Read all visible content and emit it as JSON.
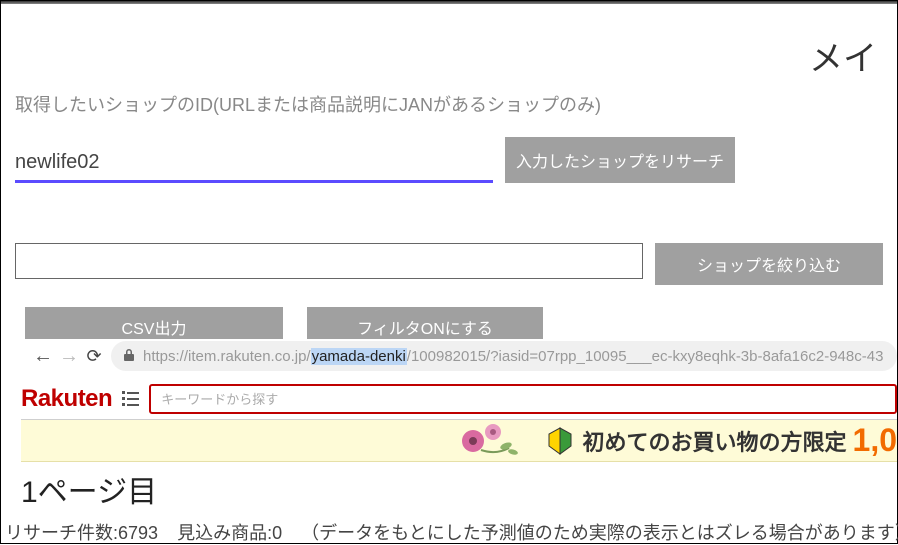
{
  "header": {
    "title_partial": "メイ"
  },
  "form": {
    "shop_id_label": "取得したいショップのID(URLまたは商品説明にJANがあるショップのみ)",
    "shop_id_value": "newlife02",
    "research_button": "入力したショップをリサーチ",
    "filter_value": "",
    "filter_button": "ショップを絞り込む",
    "csv_button": "CSV出力",
    "filter_toggle_button": "フィルタONにする"
  },
  "browser": {
    "url_prefix": "https://item.rakuten.co.jp/",
    "url_highlighted": "yamada-denki",
    "url_suffix": "/100982015/?iasid=07rpp_10095___ec-kxy8eqhk-3b-8afa16c2-948c-43"
  },
  "rakuten": {
    "logo": "Rakuten",
    "search_placeholder": "キーワードから探す"
  },
  "promo": {
    "text": "初めてのお買い物の方限定",
    "price_partial": "1,0"
  },
  "page": {
    "heading": "1ページ目",
    "research_count_label": "リサーチ件数:",
    "research_count": "6793",
    "mikomi_label": "見込み商品:",
    "mikomi_count": "0",
    "note": "（データをもとにした予測値のため実際の表示とはズレる場合があります）"
  }
}
